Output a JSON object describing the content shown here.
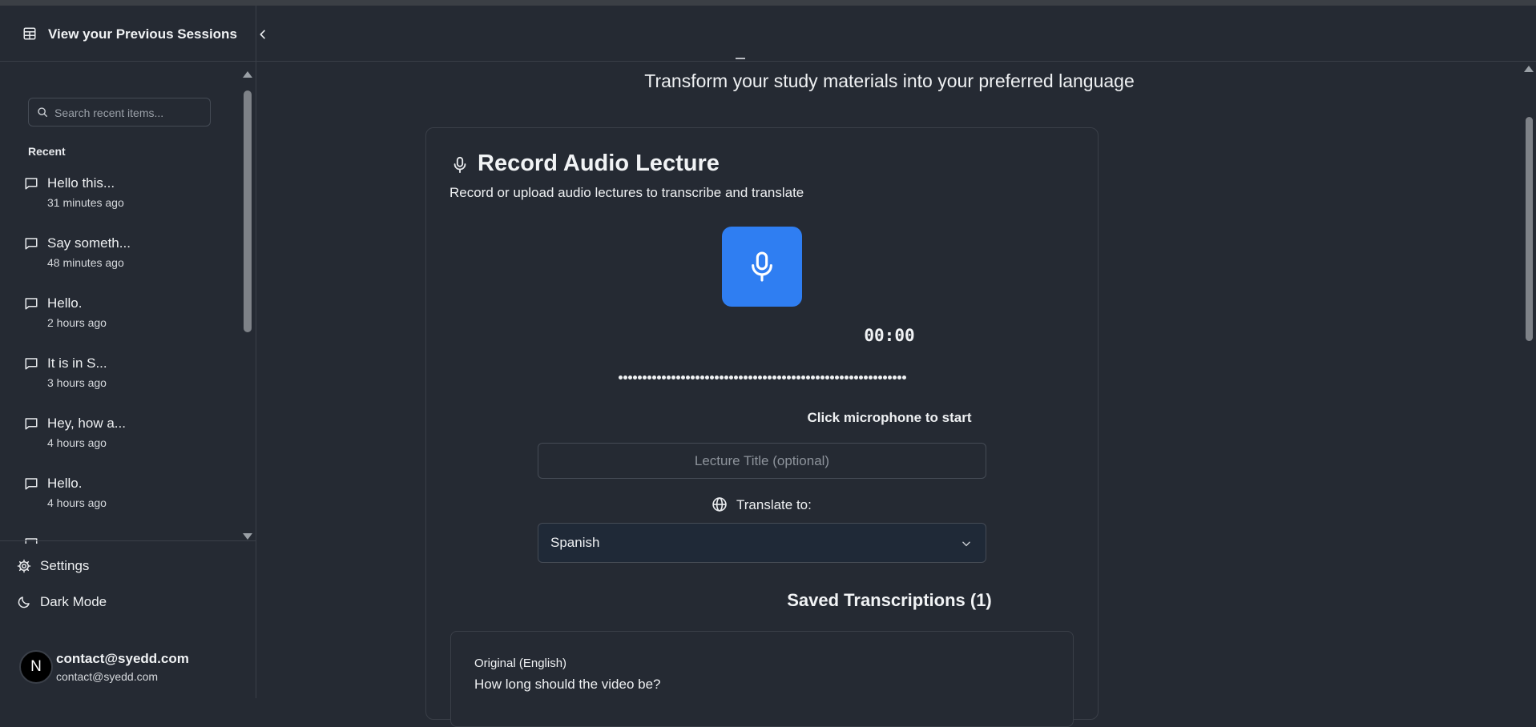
{
  "sidebar": {
    "header_title": "View your Previous Sessions",
    "search_placeholder": "Search recent items...",
    "recent_label": "Recent",
    "items": [
      {
        "title": "Hello this...",
        "time": "31 minutes ago"
      },
      {
        "title": "Say someth...",
        "time": "48 minutes ago"
      },
      {
        "title": "Hello.",
        "time": "2 hours ago"
      },
      {
        "title": "It is in S...",
        "time": "3 hours ago"
      },
      {
        "title": "Hey, how a...",
        "time": "4 hours ago"
      },
      {
        "title": "Hello.",
        "time": "4 hours ago"
      }
    ],
    "settings_label": "Settings",
    "dark_mode_label": "Dark Mode",
    "user": {
      "initial": "N",
      "name": "contact@syedd.com",
      "email": "contact@syedd.com"
    }
  },
  "main": {
    "subtitle": "Transform your study materials into your preferred language",
    "card": {
      "title": "Record Audio Lecture",
      "description": "Record or upload audio lectures to transcribe and translate",
      "timer": "00:00",
      "status": "Click microphone to start",
      "title_placeholder": "Lecture Title (optional)",
      "translate_label": "Translate to:",
      "selected_language": "Spanish",
      "saved_title": "Saved Transcriptions (1)",
      "transcription": {
        "original_label": "Original (English)",
        "original_text": "How long should the video be?"
      }
    }
  },
  "colors": {
    "background": "#252a33",
    "accent": "#2f7ef2",
    "border": "#3a3f48",
    "text": "#eef0f2"
  },
  "icons": {
    "header": "table-icon",
    "search": "search-icon",
    "chat": "message-square-icon",
    "settings": "gear-icon",
    "dark_mode": "moon-icon",
    "collapse": "chevron-left-icon",
    "mic": "microphone-icon",
    "globe": "globe-icon",
    "dropdown": "chevron-down-icon"
  }
}
